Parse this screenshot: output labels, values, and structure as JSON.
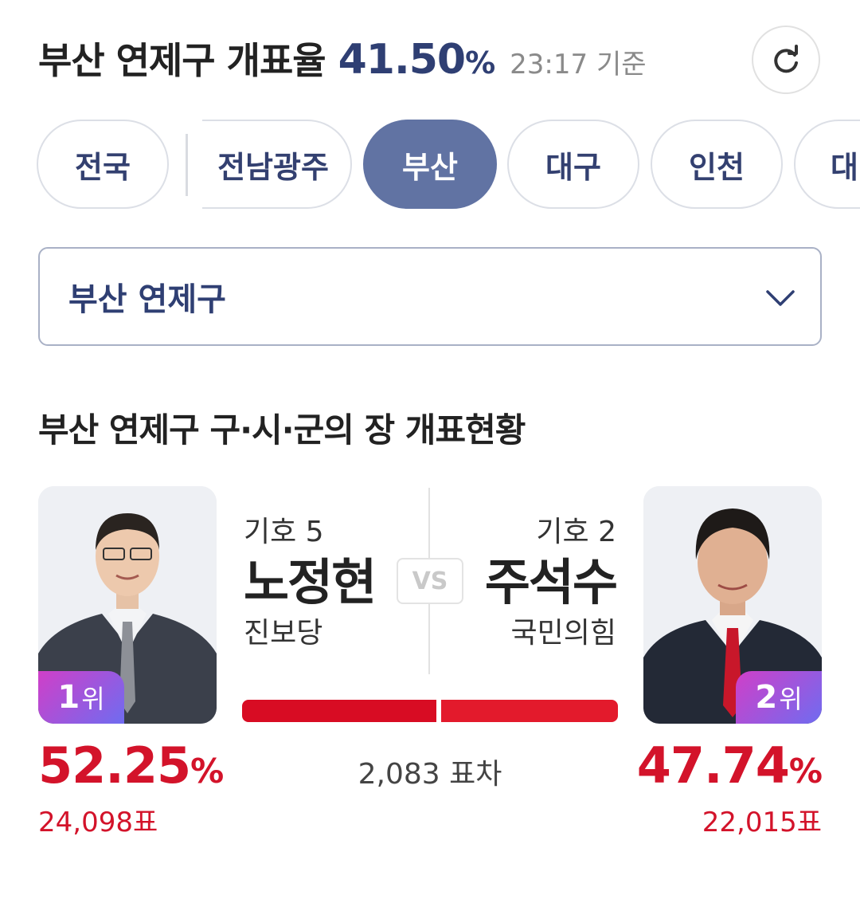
{
  "header": {
    "title": "부산 연제구 개표율",
    "rate": "41.50",
    "rate_unit": "%",
    "time": "23:17 기준"
  },
  "tabs": [
    {
      "label": "전국",
      "active": false
    },
    {
      "label": "전남광주",
      "active": false
    },
    {
      "label": "부산",
      "active": true
    },
    {
      "label": "대구",
      "active": false
    },
    {
      "label": "인천",
      "active": false
    },
    {
      "label": "대",
      "active": false
    }
  ],
  "dropdown": {
    "selected": "부산 연제구"
  },
  "section": {
    "title": "부산 연제구 구·시·군의 장 개표현황"
  },
  "vs_label": "VS",
  "candidates": [
    {
      "number": "기호 5",
      "name": "노정현",
      "party": "진보당",
      "rank_num": "1",
      "rank_unit": "위",
      "percent": "52.25",
      "percent_unit": "%",
      "votes": "24,098표",
      "share": 52.25,
      "bar_color": "#d80c23"
    },
    {
      "number": "기호 2",
      "name": "주석수",
      "party": "국민의힘",
      "rank_num": "2",
      "rank_unit": "위",
      "percent": "47.74",
      "percent_unit": "%",
      "votes": "22,015표",
      "share": 47.74,
      "bar_color": "#e31a2c"
    }
  ],
  "vote_gap": "2,083 표차",
  "colors": {
    "accent": "#2f3f73",
    "active_tab": "#6173a3",
    "result_red": "#d3132a"
  }
}
